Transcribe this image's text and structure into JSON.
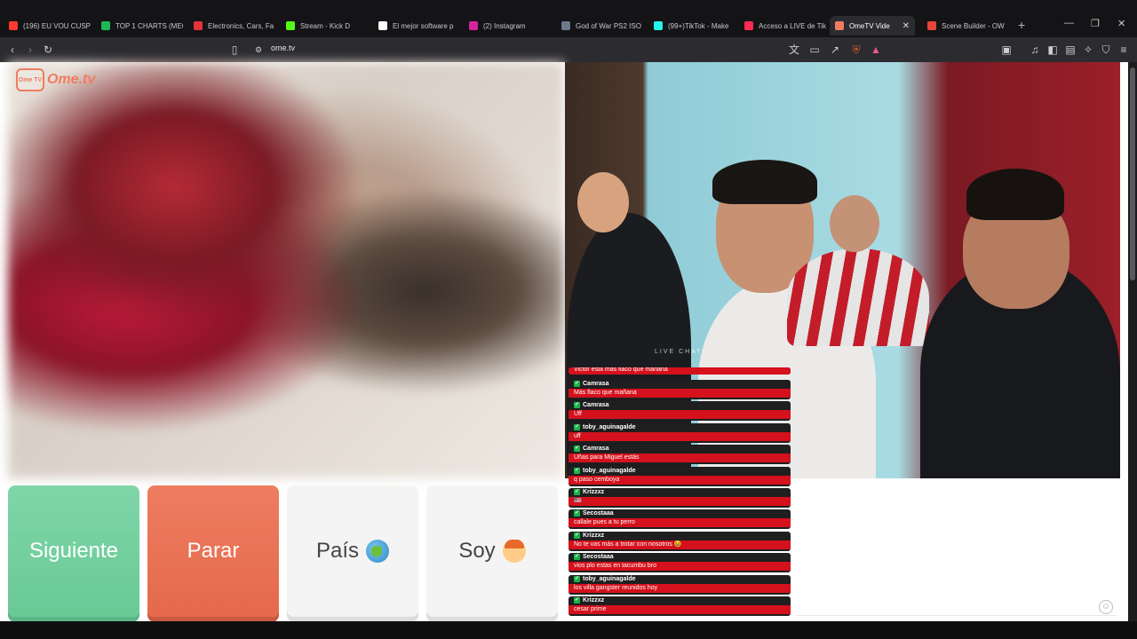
{
  "browser": {
    "tabs": [
      {
        "label": "(196) EU VOU CUSP",
        "favicon_color": "#ff3b30"
      },
      {
        "label": "TOP 1 CHARTS (MEG",
        "favicon_color": "#1db954"
      },
      {
        "label": "Electronics, Cars, Fa",
        "favicon_color": "#e53238"
      },
      {
        "label": "Stream - Kick D",
        "favicon_color": "#53fc18"
      },
      {
        "label": "El mejor software p",
        "favicon_color": "#ffffff"
      },
      {
        "label": "(2) Instagram",
        "favicon_color": "#d6249f"
      },
      {
        "label": "God of War PS2 ISO",
        "favicon_color": "#6a7a8c"
      },
      {
        "label": "(99+)TikTok - Make",
        "favicon_color": "#25f4ee"
      },
      {
        "label": "Acceso a LIVE de Tik",
        "favicon_color": "#fe2c55"
      },
      {
        "label": "OmeTV Vide",
        "favicon_color": "#f07c5f",
        "active": true
      },
      {
        "label": "Scene Builder - OW",
        "favicon_color": "#e8453c"
      }
    ],
    "url": "ome.tv"
  },
  "site": {
    "logo_badge": "Ome TV",
    "logo_wordmark": "Ome.tv",
    "live_chat_label": "LIVE CHAT"
  },
  "chat": {
    "top_partial": "Victor esta más flaco que mañana",
    "messages": [
      {
        "user": "Camrasa",
        "text": "Más flaco que mañana"
      },
      {
        "user": "Camrasa",
        "text": "Uff"
      },
      {
        "user": "toby_aguinagalde",
        "text": "uff"
      },
      {
        "user": "Camrasa",
        "text": "Uñas para Miguel estás"
      },
      {
        "user": "toby_aguinagalde",
        "text": "q paso cemboya"
      },
      {
        "user": "Krizzxz",
        "text": "🇺🇸"
      },
      {
        "user": "Secostaaa",
        "text": "callale pues a tu perro"
      },
      {
        "user": "Krizzxz",
        "text": "No te vas más a trotar con nosotros 😆"
      },
      {
        "user": "Secostaaa",
        "text": "vios plo estas en tacumbu bro"
      },
      {
        "user": "toby_aguinagalde",
        "text": "los villa gangster reunidos hoy"
      },
      {
        "user": "Krizzxz",
        "text": "cesar prime"
      }
    ]
  },
  "controls": {
    "next_label": "Siguiente",
    "stop_label": "Parar",
    "country_label": "País",
    "me_label": "Soy"
  },
  "colors": {
    "next": "#7fd6a9",
    "stop": "#ee7d60",
    "chat_text_bg": "#d4111c"
  }
}
